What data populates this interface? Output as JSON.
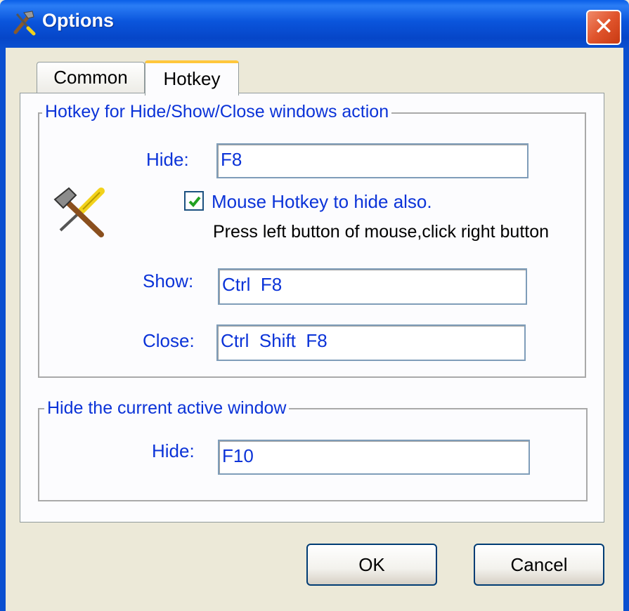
{
  "window": {
    "title": "Options",
    "close_glyph": "✕"
  },
  "tabs": [
    {
      "label": "Common",
      "active": false
    },
    {
      "label": "Hotkey",
      "active": true
    }
  ],
  "group_windows_action": {
    "legend": "Hotkey for Hide/Show/Close windows action",
    "hide_label": "Hide:",
    "hide_value": "F8",
    "mouse_hotkey_checked": true,
    "mouse_hotkey_label": "Mouse Hotkey to hide also.",
    "mouse_hotkey_hint": "Press left button of mouse,click right button",
    "show_label": "Show:",
    "show_value": "Ctrl  F8",
    "close_label": "Close:",
    "close_value": "Ctrl  Shift  F8"
  },
  "group_active_window": {
    "legend": "Hide the current active window",
    "hide_label": "Hide:",
    "hide_value": "F10"
  },
  "buttons": {
    "ok": "OK",
    "cancel": "Cancel"
  },
  "icons": {
    "app": "tools-icon",
    "settings": "hammer-screwdriver-icon"
  },
  "colors": {
    "accent": "#0b33d8",
    "titlebar": "#0a55dc",
    "tab_highlight": "#ffc73c"
  }
}
